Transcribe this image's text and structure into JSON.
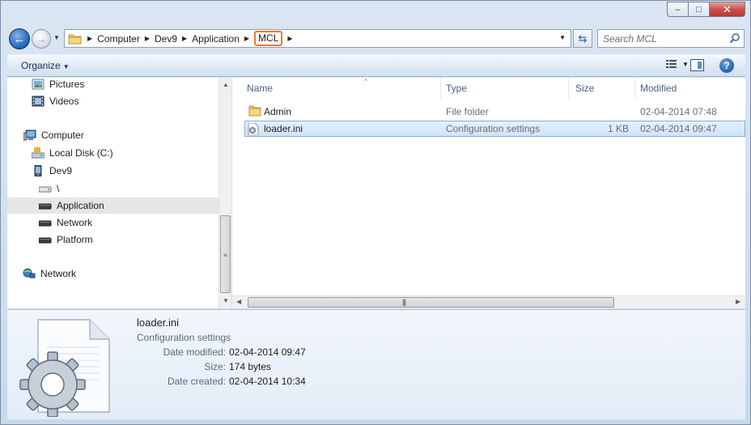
{
  "window": {
    "caption": {
      "minimize": "–",
      "maximize": "□",
      "close": "✕"
    }
  },
  "nav": {
    "back_icon": "back-arrow-icon",
    "forward_icon": "forward-arrow-icon",
    "breadcrumb": [
      "Computer",
      "Dev9",
      "Application",
      "MCL"
    ],
    "active_crumb_highlight": "#ea7a2e",
    "search_placeholder": "Search MCL"
  },
  "toolbar": {
    "organize_label": "Organize",
    "help_label": "?"
  },
  "sidebar": {
    "items": [
      {
        "label": "Pictures",
        "icon": "pictures-icon"
      },
      {
        "label": "Videos",
        "icon": "videos-icon"
      },
      {
        "label": "Computer",
        "icon": "computer-icon"
      },
      {
        "label": "Local Disk (C:)",
        "icon": "local-disk-icon"
      },
      {
        "label": "Dev9",
        "icon": "device-icon"
      },
      {
        "label": "\\",
        "icon": "drive-icon"
      },
      {
        "label": "Application",
        "icon": "drive-icon",
        "selected": true
      },
      {
        "label": "Network",
        "icon": "drive-icon"
      },
      {
        "label": "Platform",
        "icon": "drive-icon"
      },
      {
        "label": "Network",
        "icon": "network-icon"
      }
    ]
  },
  "filelist": {
    "columns": [
      "Name",
      "Type",
      "Size",
      "Modified"
    ],
    "sorted_by": "Name",
    "rows": [
      {
        "name": "Admin",
        "type": "File folder",
        "size": "",
        "modified": "02-04-2014 07:48",
        "icon": "folder-icon",
        "selected": false
      },
      {
        "name": "loader.ini",
        "type": "Configuration settings",
        "size": "1 KB",
        "modified": "02-04-2014 09:47",
        "icon": "config-file-icon",
        "selected": true
      }
    ],
    "selection_color": "#cfe4fa"
  },
  "details": {
    "name": "loader.ini",
    "type": "Configuration settings",
    "props": [
      {
        "label": "Date modified:",
        "value": "02-04-2014 09:47"
      },
      {
        "label": "Size:",
        "value": "174 bytes"
      },
      {
        "label": "Date created:",
        "value": "02-04-2014 10:34"
      }
    ],
    "icon": "config-file-large-icon"
  }
}
